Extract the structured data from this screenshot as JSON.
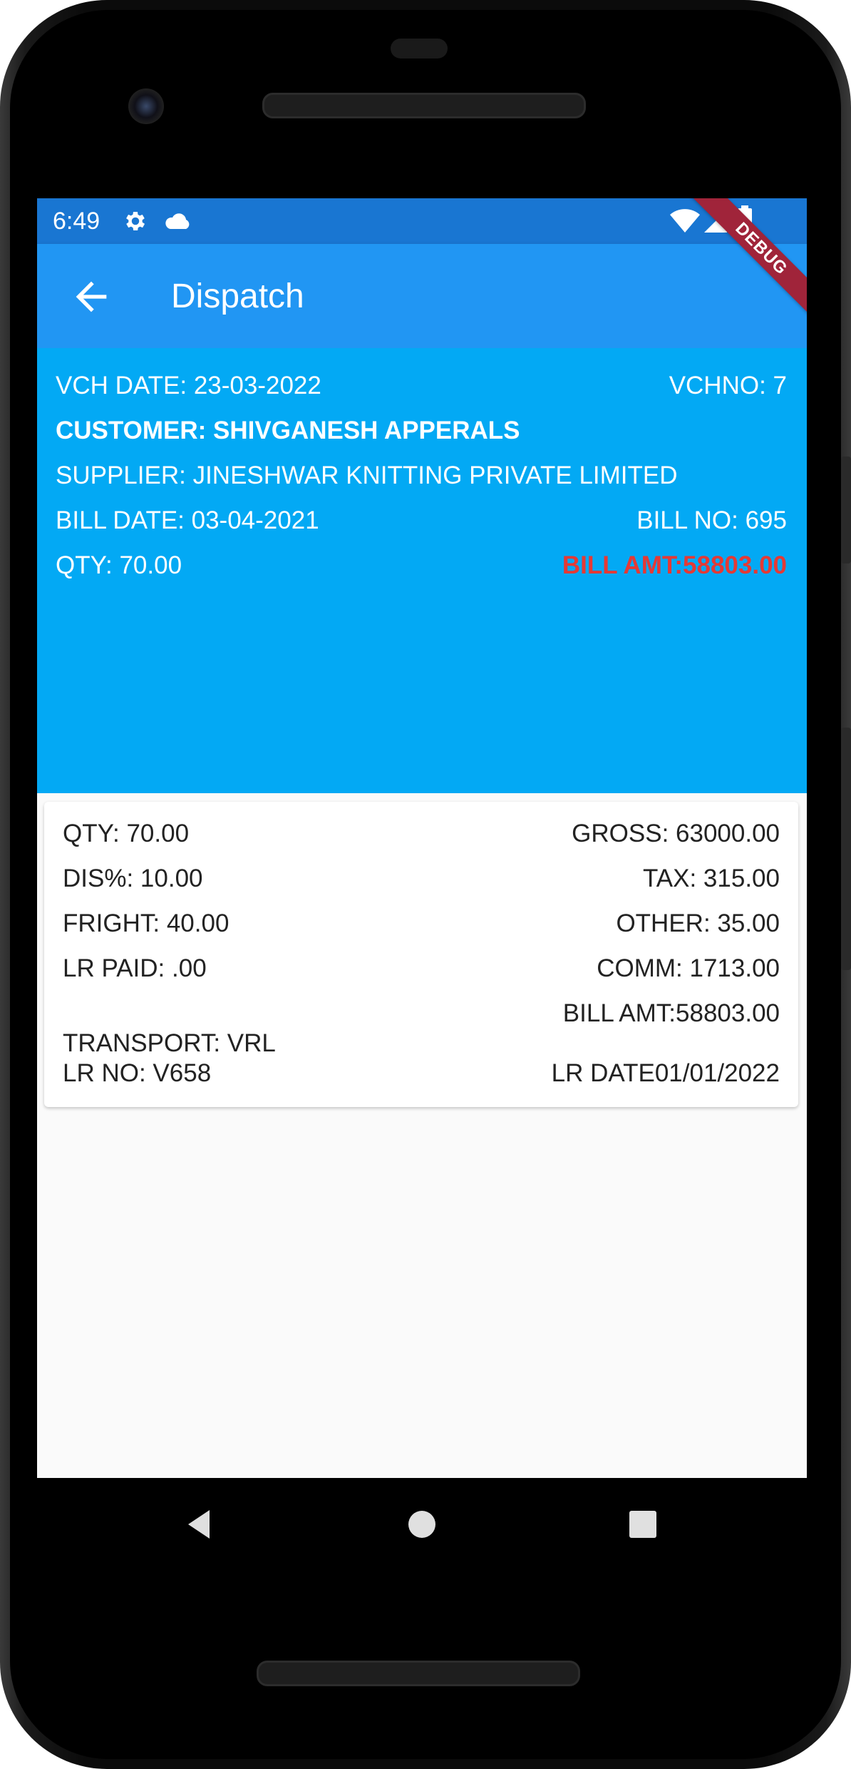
{
  "status_bar": {
    "time": "6:49",
    "icons": [
      "gear-icon",
      "cloud-icon",
      "wifi-icon",
      "signal-icon",
      "battery-icon"
    ]
  },
  "app_bar": {
    "title": "Dispatch",
    "back_icon": "arrow-left-icon",
    "debug_banner": "DEBUG",
    "color": "#2196f3"
  },
  "header": {
    "vch_date": "VCH DATE: 23-03-2022",
    "vch_no": "VCHNO: 7",
    "customer": "CUSTOMER: SHIVGANESH APPERALS",
    "supplier": "SUPPLIER: JINESHWAR KNITTING PRIVATE LIMITED",
    "bill_date": "BILL DATE: 03-04-2021",
    "bill_no": "BILL NO: 695",
    "qty": "QTY: 70.00",
    "bill_amt": "BILL AMT:58803.00",
    "color": "#03a9f4",
    "bill_amt_color": "#e53935"
  },
  "details": {
    "qty": "QTY: 70.00",
    "gross": "GROSS: 63000.00",
    "dis": "DIS%: 10.00",
    "tax": "TAX: 315.00",
    "fright": "FRIGHT: 40.00",
    "other": "OTHER: 35.00",
    "lr_paid": "LR PAID: .00",
    "comm": "COMM: 1713.00",
    "bill_amt": "BILL AMT:58803.00",
    "transport": "TRANSPORT: VRL",
    "lr_no": "LR NO: V658",
    "lr_date": "LR DATE01/01/2022"
  },
  "nav_bar": {
    "icons": [
      "back-triangle-icon",
      "home-circle-icon",
      "recents-square-icon"
    ]
  }
}
